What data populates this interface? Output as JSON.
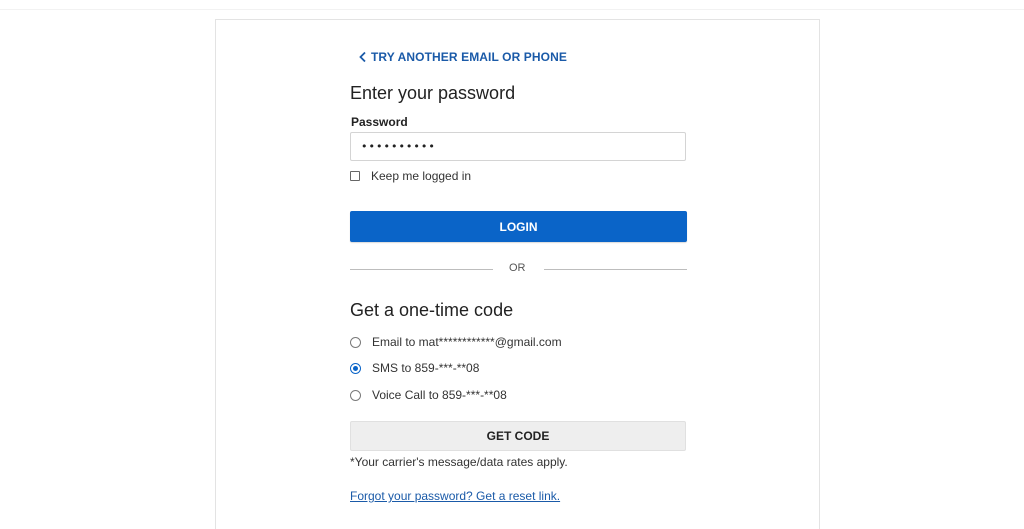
{
  "nav": {
    "back_label": "TRY ANOTHER EMAIL OR PHONE"
  },
  "password_section": {
    "title": "Enter your password",
    "field_label": "Password",
    "field_value": "••••••••••",
    "keep_logged_in_label": "Keep me logged in",
    "keep_logged_in_checked": false,
    "login_button_label": "LOGIN"
  },
  "divider": {
    "label": "OR"
  },
  "otp_section": {
    "title": "Get a one-time code",
    "options": [
      {
        "label": "Email to mat************@gmail.com",
        "selected": false
      },
      {
        "label": "SMS to 859-***-**08",
        "selected": true
      },
      {
        "label": "Voice Call to 859-***-**08",
        "selected": false
      }
    ],
    "get_code_button_label": "GET CODE",
    "rates_note": "*Your carrier's message/data rates apply.",
    "reset_link_label": "Forgot your password? Get a reset link."
  },
  "colors": {
    "primary_blue": "#0a64c8",
    "link_blue": "#1a5aa8",
    "secondary_button_bg": "#eeeeee"
  },
  "icons": {
    "back": "chevron-left-icon"
  }
}
